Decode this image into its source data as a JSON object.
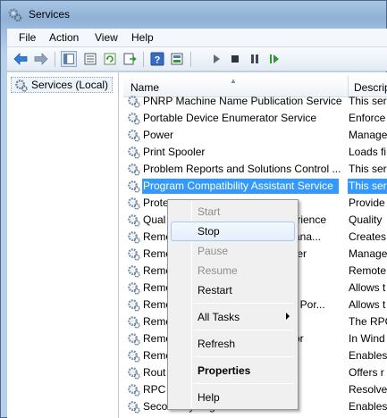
{
  "window": {
    "title": "Services"
  },
  "menu": [
    "File",
    "Action",
    "View",
    "Help"
  ],
  "toolbar": {
    "icons": [
      "back-icon",
      "forward-icon",
      "show-hide-console-tree-icon",
      "properties-page-icon",
      "refresh-icon",
      "export-list-icon",
      "help-icon",
      "properties-icon",
      "start-service-icon",
      "stop-service-icon",
      "pause-service-icon",
      "restart-service-icon"
    ]
  },
  "tree": {
    "root_label": "Services (Local)"
  },
  "columns": {
    "name": "Name",
    "description": "Descript"
  },
  "rows": [
    {
      "name": "PNRP Machine Name Publication Service",
      "desc": "This ser"
    },
    {
      "name": "Portable Device Enumerator Service",
      "desc": "Enforce"
    },
    {
      "name": "Power",
      "desc": "Manage"
    },
    {
      "name": "Print Spooler",
      "desc": "Loads fi"
    },
    {
      "name": "Problem Reports and Solutions Control ...",
      "desc": "This ser"
    },
    {
      "name": "Program Compatibility Assistant Service",
      "desc": "This ser",
      "selected": true
    },
    {
      "name": "Prote",
      "desc": "Provide"
    },
    {
      "name": "Qual",
      "suffix": "perience",
      "desc": "Quality"
    },
    {
      "name": "Remo",
      "suffix": "Mana...",
      "desc": "Creates"
    },
    {
      "name": "Remo",
      "suffix": "ager",
      "desc": "Manage"
    },
    {
      "name": "Remo",
      "suffix": "",
      "desc": "Remote"
    },
    {
      "name": "Remo",
      "suffix": "",
      "desc": "Allows t"
    },
    {
      "name": "Remo",
      "suffix": "de Por...",
      "desc": "Allows t"
    },
    {
      "name": "Remo",
      "suffix": "",
      "desc": "The RPC"
    },
    {
      "name": "Remo",
      "suffix": "ator",
      "desc": "In Wind"
    },
    {
      "name": "Remo",
      "suffix": "",
      "desc": "Enables"
    },
    {
      "name": "Rout",
      "suffix": "",
      "desc": "Offers r"
    },
    {
      "name": "RPC",
      "suffix": "",
      "desc": "Resolve"
    },
    {
      "name": "Secondary Logon",
      "desc": "Enables"
    }
  ],
  "context_menu": {
    "start": "Start",
    "stop": "Stop",
    "pause": "Pause",
    "resume": "Resume",
    "restart": "Restart",
    "all_tasks": "All Tasks",
    "refresh": "Refresh",
    "properties": "Properties",
    "help": "Help"
  },
  "colors": {
    "selection": "#3399ff",
    "window_frame": "#a9c4e2"
  }
}
